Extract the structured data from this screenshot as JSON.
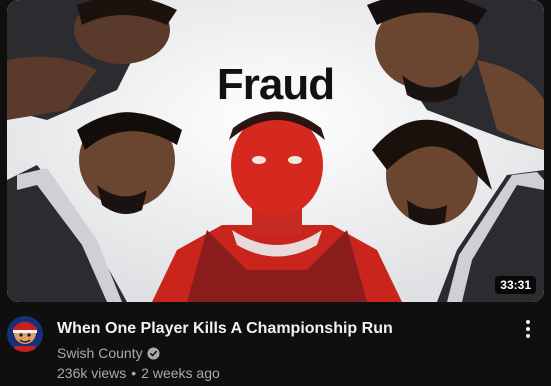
{
  "video": {
    "thumbnail_text": "Fraud",
    "duration": "33:31",
    "title": "When One Player Kills A Championship Run",
    "channel": "Swish County",
    "views": "236k views",
    "separator": "•",
    "age": "2 weeks ago"
  },
  "colors": {
    "background": "#0f0f0f",
    "title_text": "#f1f1f1",
    "secondary_text": "#aaaaaa",
    "thumbnail_bg": "#f2f3f4",
    "red_player": "#d5281f",
    "jersey": "#2b2b30"
  },
  "icons": {
    "verified": "verified-check-icon",
    "menu": "more-vertical-icon"
  }
}
